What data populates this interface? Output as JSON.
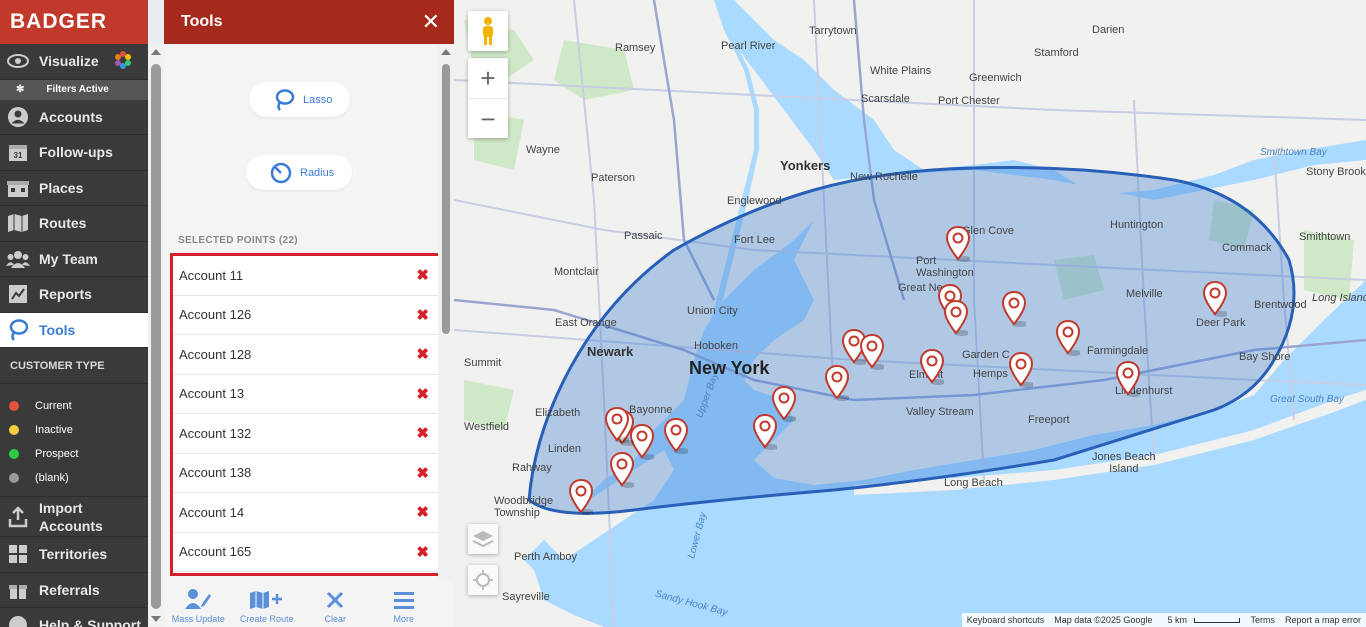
{
  "app": {
    "logo": "BADGER"
  },
  "nav": {
    "visualize": "Visualize",
    "filters_active": "Filters Active",
    "accounts": "Accounts",
    "followups": "Follow-ups",
    "places": "Places",
    "routes": "Routes",
    "myteam": "My Team",
    "reports": "Reports",
    "tools": "Tools",
    "customer_type_head": "CUSTOMER TYPE",
    "legend": [
      {
        "label": "Current",
        "color": "#e8513f"
      },
      {
        "label": "Inactive",
        "color": "#f4d03f"
      },
      {
        "label": "Prospect",
        "color": "#2ecc40"
      },
      {
        "label": "(blank)",
        "color": "#999999"
      }
    ],
    "import_accounts": "Import Accounts",
    "territories": "Territories",
    "referrals": "Referrals",
    "help": "Help & Support"
  },
  "tools": {
    "title": "Tools",
    "close": "✕",
    "lasso": "Lasso",
    "radius": "Radius",
    "selected_head": "SELECTED POINTS (22)",
    "accounts": [
      "Account 11",
      "Account 126",
      "Account 128",
      "Account 13",
      "Account 132",
      "Account 138",
      "Account 14",
      "Account 165"
    ],
    "remove_glyph": "✖",
    "footer": {
      "mass_update": "Mass Update",
      "create_route": "Create Route",
      "clear": "Clear",
      "more": "More"
    }
  },
  "map": {
    "labels": {
      "ramsey": "Ramsey",
      "pearl_river": "Pearl River",
      "tarrytown": "Tarrytown",
      "stamford": "Stamford",
      "darien": "Darien",
      "white_plains": "White Plains",
      "greenwich": "Greenwich",
      "scarsdale": "Scarsdale",
      "port_chester": "Port Chester",
      "wayne": "Wayne",
      "yonkers": "Yonkers",
      "paterson": "Paterson",
      "new_rochelle": "New Rochelle",
      "englewood": "Englewood",
      "smithtown_bay": "Smithtown Bay",
      "stony_brook": "Stony Brook",
      "huntington": "Huntington",
      "glen_cove": "Glen Cove",
      "port_washington": "Port\nWashington",
      "commack": "Commack",
      "smithtown": "Smithtown",
      "passaic": "Passaic",
      "fort_lee": "Fort Lee",
      "montclair": "Montclair",
      "great_neck": "Great Ne",
      "melville": "Melville",
      "brentwood": "Brentwood",
      "long_island": "Long Island",
      "union_city": "Union City",
      "east_orange": "East Orange",
      "deer_park": "Deer Park",
      "newark": "Newark",
      "hoboken": "Hoboken",
      "garden_city": "Garden C",
      "farmingdale": "Farmingdale",
      "bay_shore": "Bay Shore",
      "summit": "Summit",
      "new_york": "New York",
      "hempstead": "Hemps",
      "elmont": "Elmont",
      "lindenhurst": "Lindenhurst",
      "elizabeth": "Elizabeth",
      "bayonne": "Bayonne",
      "upper_bay": "Upper Bay",
      "valley_stream": "Valley Stream",
      "freeport": "Freeport",
      "great_south_bay": "Great South Bay",
      "westfield": "Westfield",
      "linden": "Linden",
      "rahway": "Rahway",
      "jones_beach": "Jones Beach\nIsland",
      "long_beach": "Long Beach",
      "woodbridge": "Woodbridge\nTownship",
      "lower_bay": "Lower Bay",
      "perth_amboy": "Perth Amboy",
      "sayreville": "Sayreville",
      "sandy_hook": "Sandy Hook Bay"
    },
    "attribution": {
      "shortcuts": "Keyboard shortcuts",
      "data": "Map data ©2025 Google",
      "scale": "5 km",
      "terms": "Terms",
      "report": "Report a map error"
    }
  }
}
